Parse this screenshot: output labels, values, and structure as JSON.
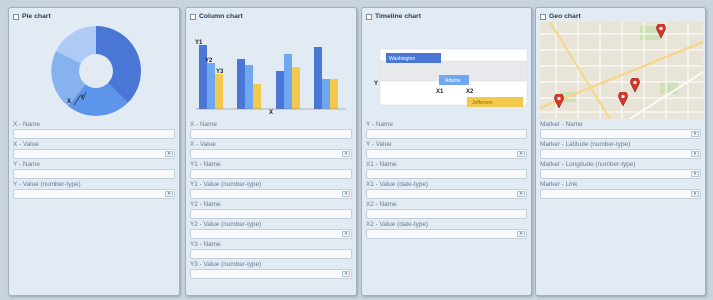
{
  "panels": {
    "pie": {
      "title": "Pie chart",
      "preview_labels": {
        "x": "X",
        "y": "Y"
      },
      "fields": [
        "X - Name",
        "X - Value",
        "Y - Name",
        "Y - Value (number-type)"
      ]
    },
    "column": {
      "title": "Column chart",
      "preview_labels": {
        "y1": "Y1",
        "y2": "Y2",
        "y3": "Y3",
        "x": "X"
      },
      "fields": [
        "X - Name",
        "X - Value",
        "Y1 - Name",
        "Y1 - Value (number-type)",
        "Y2 - Name",
        "Y2 - Value (number-type)",
        "Y3 - Name",
        "Y3 - Value (number-type)"
      ]
    },
    "timeline": {
      "title": "Timeline chart",
      "preview_labels": {
        "washington": "Washington",
        "adams": "Adams",
        "jefferson": "Jefferson",
        "y": "Y",
        "x1": "X1",
        "x2": "X2"
      },
      "fields": [
        "Y - Name",
        "Y - Value",
        "X1 - Name",
        "X1 - Value (date-type)",
        "X2 - Name",
        "X2 - Value (date-type)"
      ]
    },
    "geo": {
      "title": "Geo chart",
      "fields": [
        "Marker - Name",
        "Marker - Latitude (number-type)",
        "Marker - Longitude (number-type)",
        "Marker - Link"
      ]
    }
  },
  "icons": {
    "dropdown_arrow": "chevron-down-icon",
    "marker": "map-pin-icon"
  },
  "colors": {
    "blue": "#4a7fd9",
    "lightblue": "#6fa8f0",
    "yellow": "#f2c94c",
    "panel_bg": "#e2ebf4"
  }
}
